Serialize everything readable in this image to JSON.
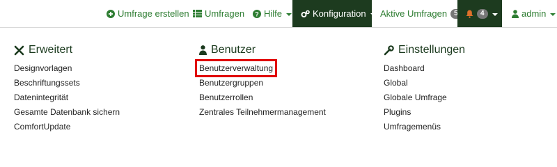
{
  "navbar": {
    "create_survey": "Umfrage erstellen",
    "surveys": "Umfragen",
    "help": "Hilfe",
    "configuration": "Konfiguration",
    "active_surveys": "Aktive Umfragen",
    "active_surveys_count": "5",
    "notifications_count": "4",
    "user": "admin"
  },
  "columns": [
    {
      "title": "Erweitert",
      "icon": "tools-icon",
      "items": [
        "Designvorlagen",
        "Beschriftungssets",
        "Datenintegrität",
        "Gesamte Datenbank sichern",
        "ComfortUpdate"
      ]
    },
    {
      "title": "Benutzer",
      "icon": "user-icon",
      "items": [
        "Benutzerverwaltung",
        "Benutzergruppen",
        "Benutzerrollen",
        "Zentrales Teilnehmermanagement"
      ]
    },
    {
      "title": "Einstellungen",
      "icon": "wrench-icon",
      "items": [
        "Dashboard",
        "Global",
        "Globale Umfrage",
        "Plugins",
        "Umfragemenüs"
      ]
    }
  ],
  "colors": {
    "accent": "#2e7d32",
    "dark": "#1d3b1f",
    "highlight": "#e00000"
  }
}
